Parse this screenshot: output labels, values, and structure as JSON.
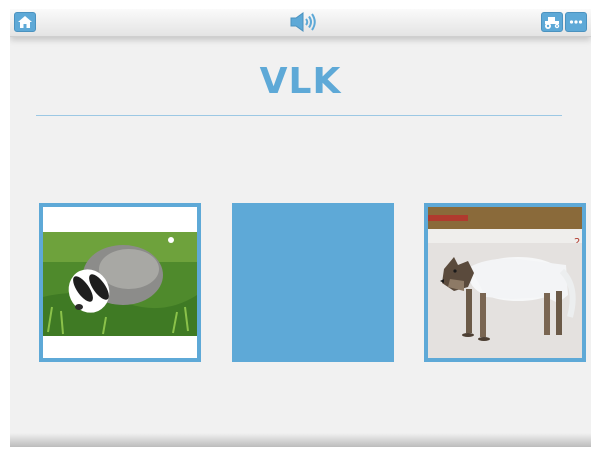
{
  "toolbar": {
    "home_icon": "home-icon",
    "sound_icon": "speaker-icon",
    "animal_icon": "tractor-icon",
    "more_icon": "ellipsis-icon"
  },
  "word": "VLK",
  "cards": [
    {
      "image": "badger-photo",
      "state": "choice"
    },
    {
      "image": "",
      "state": "blank"
    },
    {
      "image": "wolf-photo",
      "state": "choice"
    }
  ],
  "colors": {
    "accent": "#5ea9d7",
    "background": "#f1f1f1"
  }
}
